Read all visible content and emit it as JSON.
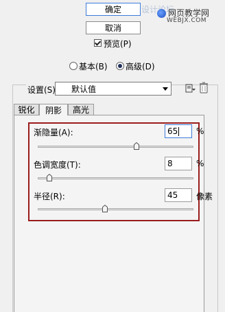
{
  "buttons": {
    "ok_label": "确定",
    "cancel_label": "取消"
  },
  "watermark": {
    "text": "设计论坛",
    "site": "网页教学网",
    "url": "WEBJX.COM"
  },
  "preview": {
    "label": "预览(P)",
    "checked": true
  },
  "mode": {
    "options": [
      {
        "label": "基本(B)",
        "selected": false
      },
      {
        "label": "高级(D)",
        "selected": true
      }
    ]
  },
  "settings": {
    "label": "设置(S):",
    "value": "默认值",
    "icons": [
      "save-preset-icon",
      "trash-icon"
    ]
  },
  "tabs": [
    {
      "label": "锐化",
      "active": false
    },
    {
      "label": "阴影",
      "active": true
    },
    {
      "label": "高光",
      "active": false
    }
  ],
  "fields": {
    "fade": {
      "label": "渐隐量(A):",
      "value": "65",
      "unit": "%",
      "level": 0.65
    },
    "tonal_width": {
      "label": "色调宽度(T):",
      "value": "8",
      "unit": "%",
      "level": 0.08
    },
    "radius": {
      "label": "半径(R):",
      "value": "45",
      "unit": "像素",
      "level": 0.45
    }
  },
  "colors": {
    "highlight_box": "#9a1c1c",
    "focus": "#3d7bd9"
  }
}
